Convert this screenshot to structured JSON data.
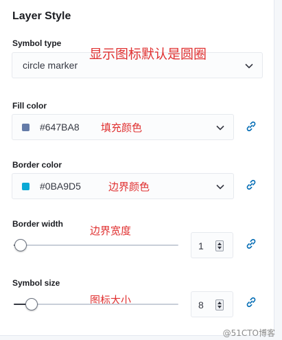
{
  "panel": {
    "title": "Layer Style"
  },
  "symbol_type": {
    "label": "Symbol type",
    "value": "circle marker",
    "annotation": "显示图标默认是圆圈"
  },
  "fill_color": {
    "label": "Fill color",
    "hex": "#647BA8",
    "swatch_color": "#647BA8",
    "annotation": "填充颜色"
  },
  "border_color": {
    "label": "Border color",
    "hex": "#0BA9D5",
    "swatch_color": "#0BA9D5",
    "annotation": "边界颜色"
  },
  "border_width": {
    "label": "Border width",
    "value": "1",
    "slider_fraction": 0.04,
    "annotation": "边界宽度"
  },
  "symbol_size": {
    "label": "Symbol size",
    "value": "8",
    "slider_fraction": 0.11,
    "annotation": "图标大小"
  },
  "colors": {
    "accent": "#006BB4",
    "annotation_red": "#E03131"
  },
  "watermark": "@51CTO博客"
}
